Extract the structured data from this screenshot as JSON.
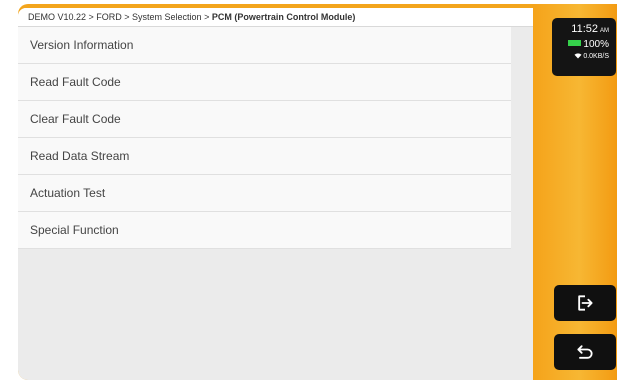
{
  "breadcrumb": {
    "path": "DEMO V10.22 > FORD > System Selection > ",
    "current": "PCM (Powertrain Control Module)"
  },
  "menu": {
    "items": [
      {
        "label": "Version Information"
      },
      {
        "label": "Read Fault Code"
      },
      {
        "label": "Clear Fault Code"
      },
      {
        "label": "Read Data Stream"
      },
      {
        "label": "Actuation Test"
      },
      {
        "label": "Special Function"
      }
    ]
  },
  "status": {
    "time": "11:52",
    "ampm": "AM",
    "battery": "100%",
    "network_speed": "0.0KB/S"
  },
  "side_buttons": {
    "exit_icon": "exit-icon",
    "back_icon": "back-icon"
  },
  "colors": {
    "accent": "#f3a51c",
    "battery": "#35d14b",
    "button": "#101010"
  }
}
